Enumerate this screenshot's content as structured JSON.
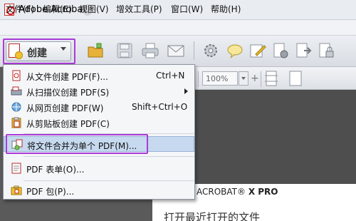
{
  "window": {
    "title": "Adobe Acrobat"
  },
  "menubar": {
    "items": [
      "文件(F)",
      "编辑(E)",
      "视图(V)",
      "增效工具(P)",
      "窗口(W)",
      "帮助(H)"
    ]
  },
  "toolbar": {
    "create_label": "创建",
    "zoom_value": "100%",
    "plus_label": "+"
  },
  "create_menu": {
    "items": [
      {
        "label": "从文件创建 PDF(F)...",
        "shortcut": "Ctrl+N",
        "submenu": false,
        "highlighted": false
      },
      {
        "label": "从扫描仪创建 PDF(S)",
        "shortcut": "",
        "submenu": true,
        "highlighted": false
      },
      {
        "label": "从网页创建 PDF(W)",
        "shortcut": "Shift+Ctrl+O",
        "submenu": false,
        "highlighted": false
      },
      {
        "label": "从剪贴板创建 PDF(C)",
        "shortcut": "",
        "submenu": false,
        "highlighted": false
      },
      {
        "label": "将文件合并为单个 PDF(M)...",
        "shortcut": "",
        "submenu": false,
        "highlighted": true
      },
      {
        "label": "PDF 表单(O)...",
        "shortcut": "",
        "submenu": false,
        "highlighted": false
      },
      {
        "label": "PDF 包(P)...",
        "shortcut": "",
        "submenu": false,
        "highlighted": false
      }
    ]
  },
  "welcome": {
    "product": "ACROBAT",
    "version": "X PRO",
    "heading": "打开最近打开的文件"
  },
  "colors": {
    "highlight_frame": "#a93bd6",
    "menu_highlight": "#c6d9ef"
  },
  "icons": [
    "pdf-logo-icon",
    "create-pdf-icon",
    "open-folder-icon",
    "save-icon",
    "print-icon",
    "email-icon",
    "settings-icon",
    "comment-icon",
    "sign-icon",
    "redact-icon",
    "export-icon",
    "protect-icon"
  ]
}
